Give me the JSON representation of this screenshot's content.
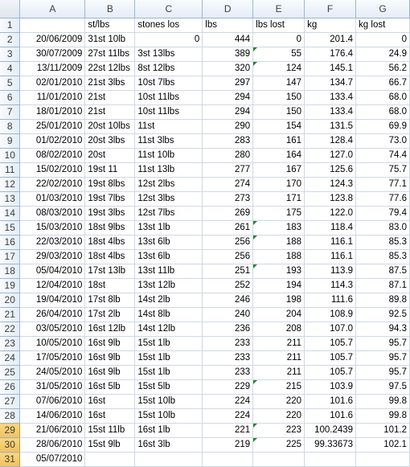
{
  "columns": [
    "A",
    "B",
    "C",
    "D",
    "E",
    "F",
    "G"
  ],
  "header_row": {
    "num": "1",
    "cells": [
      "",
      "st/lbs",
      "stones los",
      "lbs",
      "lbs lost",
      "kg",
      "kg lost"
    ]
  },
  "rows": [
    {
      "num": "2",
      "cells": [
        "20/06/2009",
        "31st 10lb",
        "0",
        "444",
        "0",
        "201.4",
        "0"
      ]
    },
    {
      "num": "3",
      "cells": [
        "30/07/2009",
        "27st 11lbs",
        "3st 13lbs",
        "389",
        "55",
        "176.4",
        "24.9"
      ]
    },
    {
      "num": "4",
      "cells": [
        "13/11/2009",
        "22st 12lbs",
        "8st 12lbs",
        "320",
        "124",
        "145.1",
        "56.2"
      ]
    },
    {
      "num": "5",
      "cells": [
        "02/01/2010",
        "21st 3lbs",
        "10st 7lbs",
        "297",
        "147",
        "134.7",
        "66.7"
      ]
    },
    {
      "num": "6",
      "cells": [
        "11/01/2010",
        "21st",
        "10st 11lbs",
        "294",
        "150",
        "133.4",
        "68.0"
      ]
    },
    {
      "num": "7",
      "cells": [
        "18/01/2010",
        "21st",
        "10st 11lbs",
        "294",
        "150",
        "133.4",
        "68.0"
      ]
    },
    {
      "num": "8",
      "cells": [
        "25/01/2010",
        "20st 10lbs",
        "11st",
        "290",
        "154",
        "131.5",
        "69.9"
      ]
    },
    {
      "num": "9",
      "cells": [
        "01/02/2010",
        "20st 3lbs",
        "11st 3lbs",
        "283",
        "161",
        "128.4",
        "73.0"
      ]
    },
    {
      "num": "10",
      "cells": [
        "08/02/2010",
        "20st",
        "11st 10lb",
        "280",
        "164",
        "127.0",
        "74.4"
      ]
    },
    {
      "num": "11",
      "cells": [
        "15/02/2010",
        "19st 11",
        "11st 13lb",
        "277",
        "167",
        "125.6",
        "75.7"
      ]
    },
    {
      "num": "12",
      "cells": [
        "22/02/2010",
        "19st 8lbs",
        "12st 2lbs",
        "274",
        "170",
        "124.3",
        "77.1"
      ]
    },
    {
      "num": "13",
      "cells": [
        "01/03/2010",
        "19st 7lbs",
        "12st 3lbs",
        "273",
        "171",
        "123.8",
        "77.6"
      ]
    },
    {
      "num": "14",
      "cells": [
        "08/03/2010",
        "19st 3lbs",
        "12st 7lbs",
        "269",
        "175",
        "122.0",
        "79.4"
      ]
    },
    {
      "num": "15",
      "cells": [
        "15/03/2010",
        "18st 9lbs",
        "13st 1lb",
        "261",
        "183",
        "118.4",
        "83.0"
      ]
    },
    {
      "num": "16",
      "cells": [
        "22/03/2010",
        "18st 4lbs",
        "13st 6lb",
        "256",
        "188",
        "116.1",
        "85.3"
      ]
    },
    {
      "num": "17",
      "cells": [
        "29/03/2010",
        "18st 4lbs",
        "13st 6lb",
        "256",
        "188",
        "116.1",
        "85.3"
      ]
    },
    {
      "num": "18",
      "cells": [
        "05/04/2010",
        "17st 13lb",
        "13st 11lb",
        "251",
        "193",
        "113.9",
        "87.5"
      ]
    },
    {
      "num": "19",
      "cells": [
        "12/04/2010",
        "18st",
        "13st 12lb",
        "252",
        "194",
        "114.3",
        "87.1"
      ]
    },
    {
      "num": "20",
      "cells": [
        "19/04/2010",
        "17st 8lb",
        "14st 2lb",
        "246",
        "198",
        "111.6",
        "89.8"
      ]
    },
    {
      "num": "21",
      "cells": [
        "26/04/2010",
        "17st 2lb",
        "14st 8lb",
        "240",
        "204",
        "108.9",
        "92.5"
      ]
    },
    {
      "num": "22",
      "cells": [
        "03/05/2010",
        "16st 12lb",
        "14st 12lb",
        "236",
        "208",
        "107.0",
        "94.3"
      ]
    },
    {
      "num": "23",
      "cells": [
        "10/05/2010",
        "16st 9lb",
        "15st 1lb",
        "233",
        "211",
        "105.7",
        "95.7"
      ]
    },
    {
      "num": "24",
      "cells": [
        "17/05/2010",
        "16st 9lb",
        "15st 1lb",
        "233",
        "211",
        "105.7",
        "95.7"
      ]
    },
    {
      "num": "25",
      "cells": [
        "24/05/2010",
        "16st 9lb",
        "15st 1lb",
        "233",
        "211",
        "105.7",
        "95.7"
      ]
    },
    {
      "num": "26",
      "cells": [
        "31/05/2010",
        "16st 5lb",
        "15st 5lb",
        "229",
        "215",
        "103.9",
        "97.5"
      ]
    },
    {
      "num": "27",
      "cells": [
        "07/06/2010",
        "16st",
        "15st 10lb",
        "224",
        "220",
        "101.6",
        "99.8"
      ]
    },
    {
      "num": "28",
      "cells": [
        "14/06/2010",
        "16st",
        "15st 10lb",
        "224",
        "220",
        "101.6",
        "99.8"
      ]
    },
    {
      "num": "29",
      "cells": [
        "21/06/2010",
        "15st 11lb",
        "16st 1lb",
        "221",
        "223",
        "100.2439",
        "101.2"
      ]
    },
    {
      "num": "30",
      "cells": [
        "28/06/2010",
        "15st 9lb",
        "16st 3lb",
        "219",
        "225",
        "99.33673",
        "102.1"
      ]
    },
    {
      "num": "31",
      "cells": [
        "05/07/2010",
        "",
        "",
        "",
        "",
        "",
        ""
      ]
    }
  ]
}
